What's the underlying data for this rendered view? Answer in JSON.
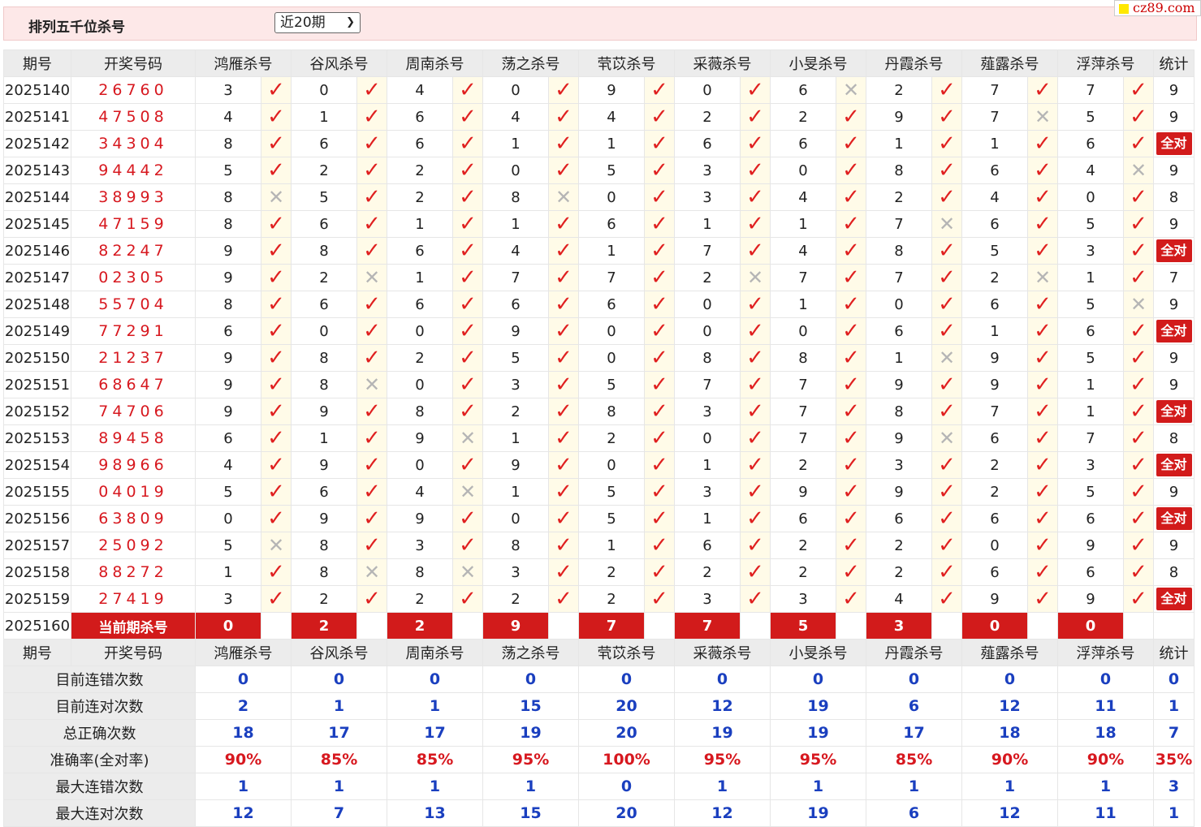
{
  "header": {
    "title": "排列五千位杀号",
    "period_select": "近20期",
    "logo": "cz89.com"
  },
  "columns": [
    "期号",
    "开奖号码",
    "鸿雁杀号",
    "谷风杀号",
    "周南杀号",
    "荡之杀号",
    "茕苡杀号",
    "采薇杀号",
    "小旻杀号",
    "丹霞杀号",
    "薤露杀号",
    "浮萍杀号",
    "统计"
  ],
  "rows": [
    {
      "id": "2025140",
      "draw": "26760",
      "kills": [
        "3",
        "0",
        "4",
        "0",
        "9",
        "0",
        "6",
        "2",
        "7",
        "7"
      ],
      "marks": [
        1,
        1,
        1,
        1,
        1,
        1,
        0,
        1,
        1,
        1
      ],
      "stat": "9"
    },
    {
      "id": "2025141",
      "draw": "47508",
      "kills": [
        "4",
        "1",
        "6",
        "4",
        "4",
        "2",
        "2",
        "9",
        "7",
        "5"
      ],
      "marks": [
        1,
        1,
        1,
        1,
        1,
        1,
        1,
        1,
        0,
        1
      ],
      "stat": "9"
    },
    {
      "id": "2025142",
      "draw": "34304",
      "kills": [
        "8",
        "6",
        "6",
        "1",
        "1",
        "6",
        "6",
        "1",
        "1",
        "6"
      ],
      "marks": [
        1,
        1,
        1,
        1,
        1,
        1,
        1,
        1,
        1,
        1
      ],
      "stat": "全对"
    },
    {
      "id": "2025143",
      "draw": "94442",
      "kills": [
        "5",
        "2",
        "2",
        "0",
        "5",
        "3",
        "0",
        "8",
        "6",
        "4"
      ],
      "marks": [
        1,
        1,
        1,
        1,
        1,
        1,
        1,
        1,
        1,
        0
      ],
      "stat": "9"
    },
    {
      "id": "2025144",
      "draw": "38993",
      "kills": [
        "8",
        "5",
        "2",
        "8",
        "0",
        "3",
        "4",
        "2",
        "4",
        "0"
      ],
      "marks": [
        0,
        1,
        1,
        0,
        1,
        1,
        1,
        1,
        1,
        1
      ],
      "stat": "8"
    },
    {
      "id": "2025145",
      "draw": "47159",
      "kills": [
        "8",
        "6",
        "1",
        "1",
        "6",
        "1",
        "1",
        "7",
        "6",
        "5"
      ],
      "marks": [
        1,
        1,
        1,
        1,
        1,
        1,
        1,
        0,
        1,
        1
      ],
      "stat": "9"
    },
    {
      "id": "2025146",
      "draw": "82247",
      "kills": [
        "9",
        "8",
        "6",
        "4",
        "1",
        "7",
        "4",
        "8",
        "5",
        "3"
      ],
      "marks": [
        1,
        1,
        1,
        1,
        1,
        1,
        1,
        1,
        1,
        1
      ],
      "stat": "全对"
    },
    {
      "id": "2025147",
      "draw": "02305",
      "kills": [
        "9",
        "2",
        "1",
        "7",
        "7",
        "2",
        "7",
        "7",
        "2",
        "1"
      ],
      "marks": [
        1,
        0,
        1,
        1,
        1,
        0,
        1,
        1,
        0,
        1
      ],
      "stat": "7"
    },
    {
      "id": "2025148",
      "draw": "55704",
      "kills": [
        "8",
        "6",
        "6",
        "6",
        "6",
        "0",
        "1",
        "0",
        "6",
        "5"
      ],
      "marks": [
        1,
        1,
        1,
        1,
        1,
        1,
        1,
        1,
        1,
        0
      ],
      "stat": "9"
    },
    {
      "id": "2025149",
      "draw": "77291",
      "kills": [
        "6",
        "0",
        "0",
        "9",
        "0",
        "0",
        "0",
        "6",
        "1",
        "6"
      ],
      "marks": [
        1,
        1,
        1,
        1,
        1,
        1,
        1,
        1,
        1,
        1
      ],
      "stat": "全对"
    },
    {
      "id": "2025150",
      "draw": "21237",
      "kills": [
        "9",
        "8",
        "2",
        "5",
        "0",
        "8",
        "8",
        "1",
        "9",
        "5"
      ],
      "marks": [
        1,
        1,
        1,
        1,
        1,
        1,
        1,
        0,
        1,
        1
      ],
      "stat": "9"
    },
    {
      "id": "2025151",
      "draw": "68647",
      "kills": [
        "9",
        "8",
        "0",
        "3",
        "5",
        "7",
        "7",
        "9",
        "9",
        "1"
      ],
      "marks": [
        1,
        0,
        1,
        1,
        1,
        1,
        1,
        1,
        1,
        1
      ],
      "stat": "9"
    },
    {
      "id": "2025152",
      "draw": "74706",
      "kills": [
        "9",
        "9",
        "8",
        "2",
        "8",
        "3",
        "7",
        "8",
        "7",
        "1"
      ],
      "marks": [
        1,
        1,
        1,
        1,
        1,
        1,
        1,
        1,
        1,
        1
      ],
      "stat": "全对"
    },
    {
      "id": "2025153",
      "draw": "89458",
      "kills": [
        "6",
        "1",
        "9",
        "1",
        "2",
        "0",
        "7",
        "9",
        "6",
        "7"
      ],
      "marks": [
        1,
        1,
        0,
        1,
        1,
        1,
        1,
        0,
        1,
        1
      ],
      "stat": "8"
    },
    {
      "id": "2025154",
      "draw": "98966",
      "kills": [
        "4",
        "9",
        "0",
        "9",
        "0",
        "1",
        "2",
        "3",
        "2",
        "3"
      ],
      "marks": [
        1,
        1,
        1,
        1,
        1,
        1,
        1,
        1,
        1,
        1
      ],
      "stat": "全对"
    },
    {
      "id": "2025155",
      "draw": "04019",
      "kills": [
        "5",
        "6",
        "4",
        "1",
        "5",
        "3",
        "9",
        "9",
        "2",
        "5"
      ],
      "marks": [
        1,
        1,
        0,
        1,
        1,
        1,
        1,
        1,
        1,
        1
      ],
      "stat": "9"
    },
    {
      "id": "2025156",
      "draw": "63809",
      "kills": [
        "0",
        "9",
        "9",
        "0",
        "5",
        "1",
        "6",
        "6",
        "6",
        "6"
      ],
      "marks": [
        1,
        1,
        1,
        1,
        1,
        1,
        1,
        1,
        1,
        1
      ],
      "stat": "全对"
    },
    {
      "id": "2025157",
      "draw": "25092",
      "kills": [
        "5",
        "8",
        "3",
        "8",
        "1",
        "6",
        "2",
        "2",
        "0",
        "9"
      ],
      "marks": [
        0,
        1,
        1,
        1,
        1,
        1,
        1,
        1,
        1,
        1
      ],
      "stat": "9"
    },
    {
      "id": "2025158",
      "draw": "88272",
      "kills": [
        "1",
        "8",
        "8",
        "3",
        "2",
        "2",
        "2",
        "2",
        "6",
        "6"
      ],
      "marks": [
        1,
        0,
        0,
        1,
        1,
        1,
        1,
        1,
        1,
        1
      ],
      "stat": "8"
    },
    {
      "id": "2025159",
      "draw": "27419",
      "kills": [
        "3",
        "2",
        "2",
        "2",
        "2",
        "3",
        "3",
        "4",
        "9",
        "9"
      ],
      "marks": [
        1,
        1,
        1,
        1,
        1,
        1,
        1,
        1,
        1,
        1
      ],
      "stat": "全对"
    }
  ],
  "current": {
    "id": "2025160",
    "label": "当前期杀号",
    "kills": [
      "0",
      "2",
      "2",
      "9",
      "7",
      "7",
      "5",
      "3",
      "0",
      "0"
    ]
  },
  "marks": {
    "ok": "✓",
    "no": "✕"
  },
  "stats": [
    {
      "label": "目前连错次数",
      "values": [
        "0",
        "0",
        "0",
        "0",
        "0",
        "0",
        "0",
        "0",
        "0",
        "0",
        "0"
      ]
    },
    {
      "label": "目前连对次数",
      "values": [
        "2",
        "1",
        "1",
        "15",
        "20",
        "12",
        "19",
        "6",
        "12",
        "11",
        "1"
      ]
    },
    {
      "label": "总正确次数",
      "values": [
        "18",
        "17",
        "17",
        "19",
        "20",
        "19",
        "19",
        "17",
        "18",
        "18",
        "7"
      ]
    },
    {
      "label": "准确率(全对率)",
      "values": [
        "90%",
        "85%",
        "85%",
        "95%",
        "100%",
        "95%",
        "95%",
        "85%",
        "90%",
        "90%",
        "35%"
      ],
      "red": true
    },
    {
      "label": "最大连错次数",
      "values": [
        "1",
        "1",
        "1",
        "1",
        "0",
        "1",
        "1",
        "1",
        "1",
        "1",
        "3"
      ]
    },
    {
      "label": "最大连对次数",
      "values": [
        "12",
        "7",
        "13",
        "15",
        "20",
        "12",
        "19",
        "6",
        "12",
        "11",
        "1"
      ]
    }
  ],
  "colors": {
    "accent_red": "#d21b1b",
    "stat_blue": "#1a3fbf",
    "header_bg": "#ececec",
    "top_bg": "#fde8e8"
  }
}
